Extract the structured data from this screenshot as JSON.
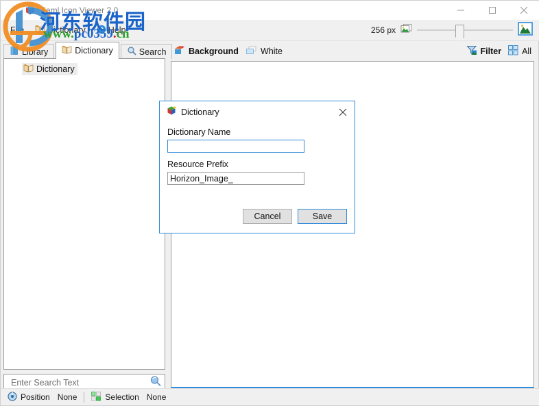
{
  "window": {
    "title": "Xaml Icon Viewer 2.0",
    "app_icon": "xaml-cube-icon",
    "controls": {
      "minimize": "minimize-icon",
      "maximize": "maximize-icon",
      "close": "close-icon"
    }
  },
  "menu": {
    "items": [
      {
        "label": "File",
        "icon": ""
      },
      {
        "label": "Dictionary",
        "icon": "book-icon"
      },
      {
        "label": "Help",
        "icon": "help-icon"
      }
    ]
  },
  "zoom": {
    "size_label": "256 px",
    "small_image_icon": "small-image-icon",
    "large_image_icon": "large-image-icon",
    "slider_value": 40
  },
  "left_panel": {
    "tabs": [
      {
        "label": "Library",
        "icon": "library-book-icon",
        "active": false
      },
      {
        "label": "Dictionary",
        "icon": "open-book-icon",
        "active": true
      },
      {
        "label": "Search",
        "icon": "magnifier-icon",
        "active": false
      }
    ],
    "tree": [
      {
        "label": "Dictionary",
        "icon": "open-book-icon",
        "selected": true
      }
    ],
    "search": {
      "placeholder": "Enter Search Text",
      "value": "",
      "icon": "magnifier-icon"
    }
  },
  "right_panel": {
    "header": {
      "background_label": "Background",
      "background_icon": "palette-icon",
      "color_label": "White",
      "color_icon": "white-swatch-icon",
      "filter_label": "Filter",
      "filter_icon": "funnel-icon",
      "all_label": "All",
      "all_icon": "grid-icon"
    }
  },
  "statusbar": {
    "position_label": "Position",
    "position_value": "None",
    "position_icon": "target-icon",
    "selection_label": "Selection",
    "selection_value": "None",
    "selection_icon": "selection-icon"
  },
  "dialog": {
    "title": "Dictionary",
    "icon": "cube-icon",
    "close_icon": "close-icon",
    "name_label": "Dictionary Name",
    "name_value": "",
    "prefix_label": "Resource Prefix",
    "prefix_value": "Horizon_Image_",
    "cancel_label": "Cancel",
    "save_label": "Save"
  },
  "watermark": {
    "chinese": "河东软件园",
    "url_www": "www.",
    "url_pc": "pc0359",
    "url_dot": ".",
    "url_cn": "cn"
  },
  "colors": {
    "accent": "#2f8ad8",
    "panel": "#f0f0f0",
    "border": "#9b9b9b",
    "watermark_blue": "#1a63c8",
    "watermark_green": "#2ba02b"
  }
}
